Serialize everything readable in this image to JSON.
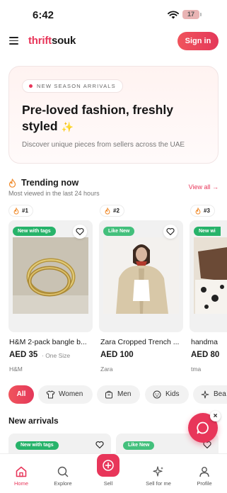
{
  "status_bar": {
    "time": "6:42",
    "battery": "17"
  },
  "header": {
    "logo_part1": "thrift",
    "logo_part2": "souk",
    "sign_in_label": "Sign in"
  },
  "hero": {
    "pill": "NEW SEASON ARRIVALS",
    "title": "Pre-loved fashion, freshly styled",
    "sparkle": "✨",
    "subtitle": "Discover unique pieces from sellers across the UAE"
  },
  "trending": {
    "title": "Trending now",
    "subtitle": "Most viewed in the last 24 hours",
    "view_all": "View all →",
    "items": [
      {
        "rank": "#1",
        "tag": "New with tags",
        "name": "H&M 2-pack bangle b...",
        "price": "AED 35",
        "size": "· One Size",
        "brand": "H&M"
      },
      {
        "rank": "#2",
        "tag": "Like New",
        "name": "Zara Cropped Trench ...",
        "price": "AED 100",
        "size": "",
        "brand": "Zara"
      },
      {
        "rank": "#3",
        "tag": "New wi",
        "name": "handma",
        "price": "AED 80",
        "size": "",
        "brand": "tma"
      }
    ]
  },
  "categories": [
    {
      "label": "All",
      "icon": "none"
    },
    {
      "label": "Women",
      "icon": "shirt-icon"
    },
    {
      "label": "Men",
      "icon": "bag-icon"
    },
    {
      "label": "Kids",
      "icon": "baby-icon"
    },
    {
      "label": "Bea",
      "icon": "sparkle-icon"
    }
  ],
  "new_arrivals": {
    "title": "New arrivals",
    "items": [
      {
        "tag": "New with tags"
      },
      {
        "tag": "Like New"
      }
    ]
  },
  "chat": {
    "close": "×"
  },
  "bottom_nav": [
    {
      "label": "Home",
      "icon": "home-icon"
    },
    {
      "label": "Explore",
      "icon": "search-icon"
    },
    {
      "label": "Sell",
      "icon": "plus-icon"
    },
    {
      "label": "Sell for me",
      "icon": "sparkle-icon"
    },
    {
      "label": "Profile",
      "icon": "user-icon"
    }
  ],
  "colors": {
    "accent": "#e8365a",
    "tag_green": "#27b36a"
  }
}
